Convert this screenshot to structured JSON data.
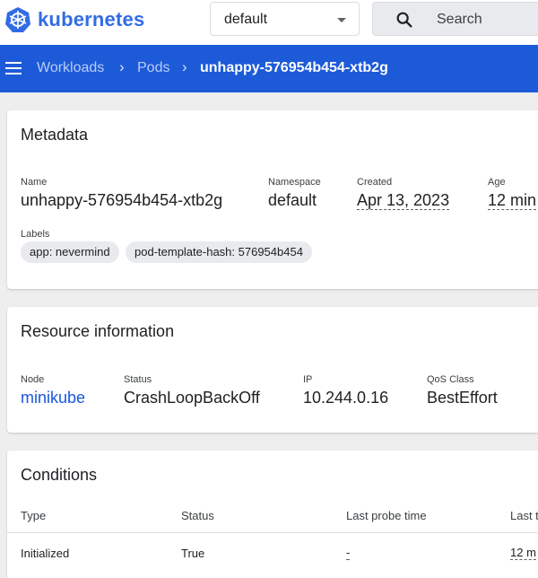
{
  "topbar": {
    "brand": "kubernetes",
    "namespace": "default",
    "search_label": "Search",
    "brand_color": "#326ce5"
  },
  "navbar": {
    "breadcrumbs": [
      "Workloads",
      "Pods"
    ],
    "current": "unhappy-576954b454-xtb2g",
    "color": "#1c5ad8"
  },
  "metadata": {
    "title": "Metadata",
    "name_label": "Name",
    "name": "unhappy-576954b454-xtb2g",
    "namespace_label": "Namespace",
    "namespace": "default",
    "created_label": "Created",
    "created": "Apr 13, 2023",
    "age_label": "Age",
    "age": "12 min",
    "labels_label": "Labels",
    "labels": [
      "app: nevermind",
      "pod-template-hash: 576954b454"
    ]
  },
  "resource": {
    "title": "Resource information",
    "node_label": "Node",
    "node": "minikube",
    "status_label": "Status",
    "status": "CrashLoopBackOff",
    "ip_label": "IP",
    "ip": "10.244.0.16",
    "qos_label": "QoS Class",
    "qos": "BestEffort"
  },
  "conditions": {
    "title": "Conditions",
    "columns": [
      "Type",
      "Status",
      "Last probe time",
      "Last t"
    ],
    "rows": [
      {
        "type": "Initialized",
        "status": "True",
        "last_probe": "-",
        "last_transition": "12 m"
      }
    ]
  }
}
